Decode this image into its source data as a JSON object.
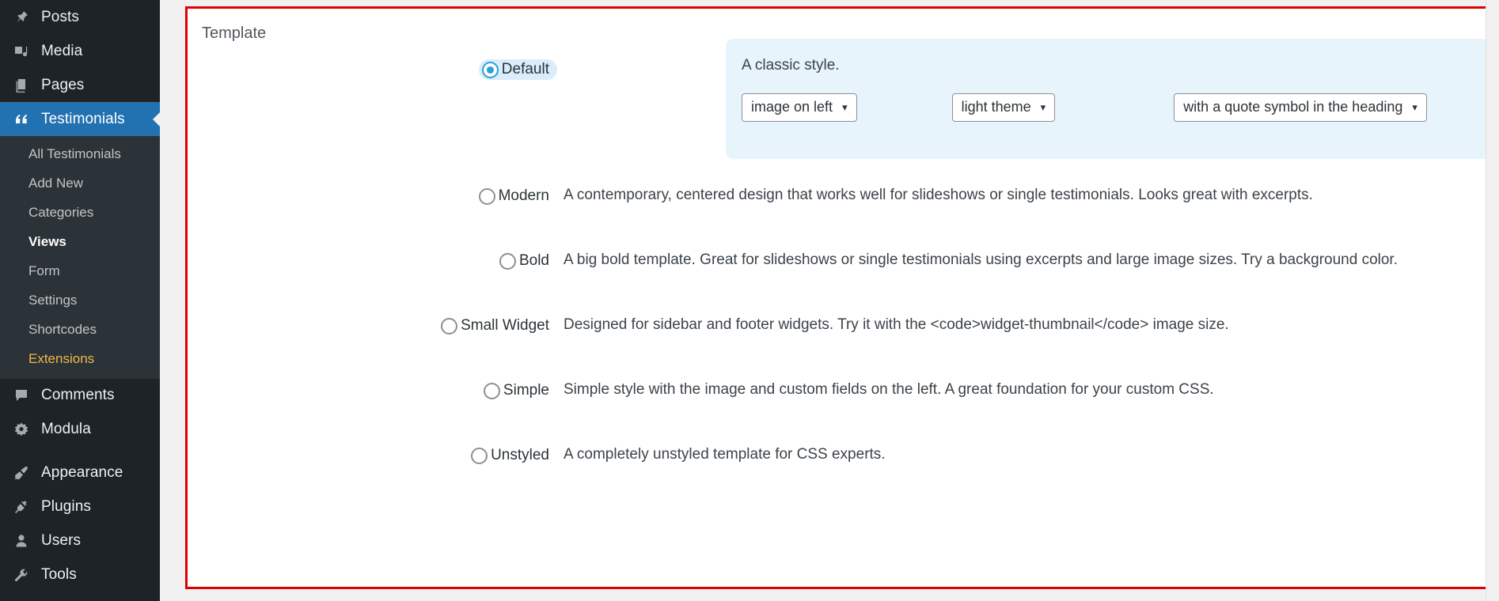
{
  "sidebar": {
    "items": [
      {
        "label": "Posts",
        "icon": "pin-icon",
        "state": "normal"
      },
      {
        "label": "Media",
        "icon": "media-icon",
        "state": "normal"
      },
      {
        "label": "Pages",
        "icon": "pages-icon",
        "state": "normal"
      },
      {
        "label": "Testimonials",
        "icon": "quote-icon",
        "state": "current"
      },
      {
        "label": "Comments",
        "icon": "comment-icon",
        "state": "normal"
      },
      {
        "label": "Modula",
        "icon": "modula-gear-icon",
        "state": "normal"
      },
      {
        "label": "Appearance",
        "icon": "paintbrush-icon",
        "state": "normal"
      },
      {
        "label": "Plugins",
        "icon": "plug-icon",
        "state": "normal"
      },
      {
        "label": "Users",
        "icon": "user-icon",
        "state": "normal"
      },
      {
        "label": "Tools",
        "icon": "wrench-icon",
        "state": "normal"
      }
    ],
    "submenu": [
      {
        "label": "All Testimonials",
        "state": "normal"
      },
      {
        "label": "Add New",
        "state": "normal"
      },
      {
        "label": "Categories",
        "state": "normal"
      },
      {
        "label": "Views",
        "state": "active"
      },
      {
        "label": "Form",
        "state": "normal"
      },
      {
        "label": "Settings",
        "state": "normal"
      },
      {
        "label": "Shortcodes",
        "state": "normal"
      },
      {
        "label": "Extensions",
        "state": "highlight"
      }
    ]
  },
  "main": {
    "section_label": "Template",
    "highlight_border_color": "#e00000",
    "accent_color": "#2a9fd8",
    "selected_panel_bg": "#e7f4fc",
    "templates": [
      {
        "name": "Default",
        "selected": true,
        "description": "A classic style.",
        "options": [
          {
            "name": "image-position-select",
            "value": "image on left"
          },
          {
            "name": "theme-select",
            "value": "light theme"
          },
          {
            "name": "heading-style-select",
            "value": "with a quote symbol in the heading"
          }
        ]
      },
      {
        "name": "Modern",
        "selected": false,
        "description": "A contemporary, centered design that works well for slideshows or single testimonials. Looks great with excerpts."
      },
      {
        "name": "Bold",
        "selected": false,
        "description": "A big bold template. Great for slideshows or single testimonials using excerpts and large image sizes. Try a background color."
      },
      {
        "name": "Small Widget",
        "selected": false,
        "description": "Designed for sidebar and footer widgets. Try it with the <code>widget-thumbnail</code> image size."
      },
      {
        "name": "Simple",
        "selected": false,
        "description": "Simple style with the image and custom fields on the left. A great foundation for your custom CSS."
      },
      {
        "name": "Unstyled",
        "selected": false,
        "description": "A completely unstyled template for CSS experts."
      }
    ]
  }
}
